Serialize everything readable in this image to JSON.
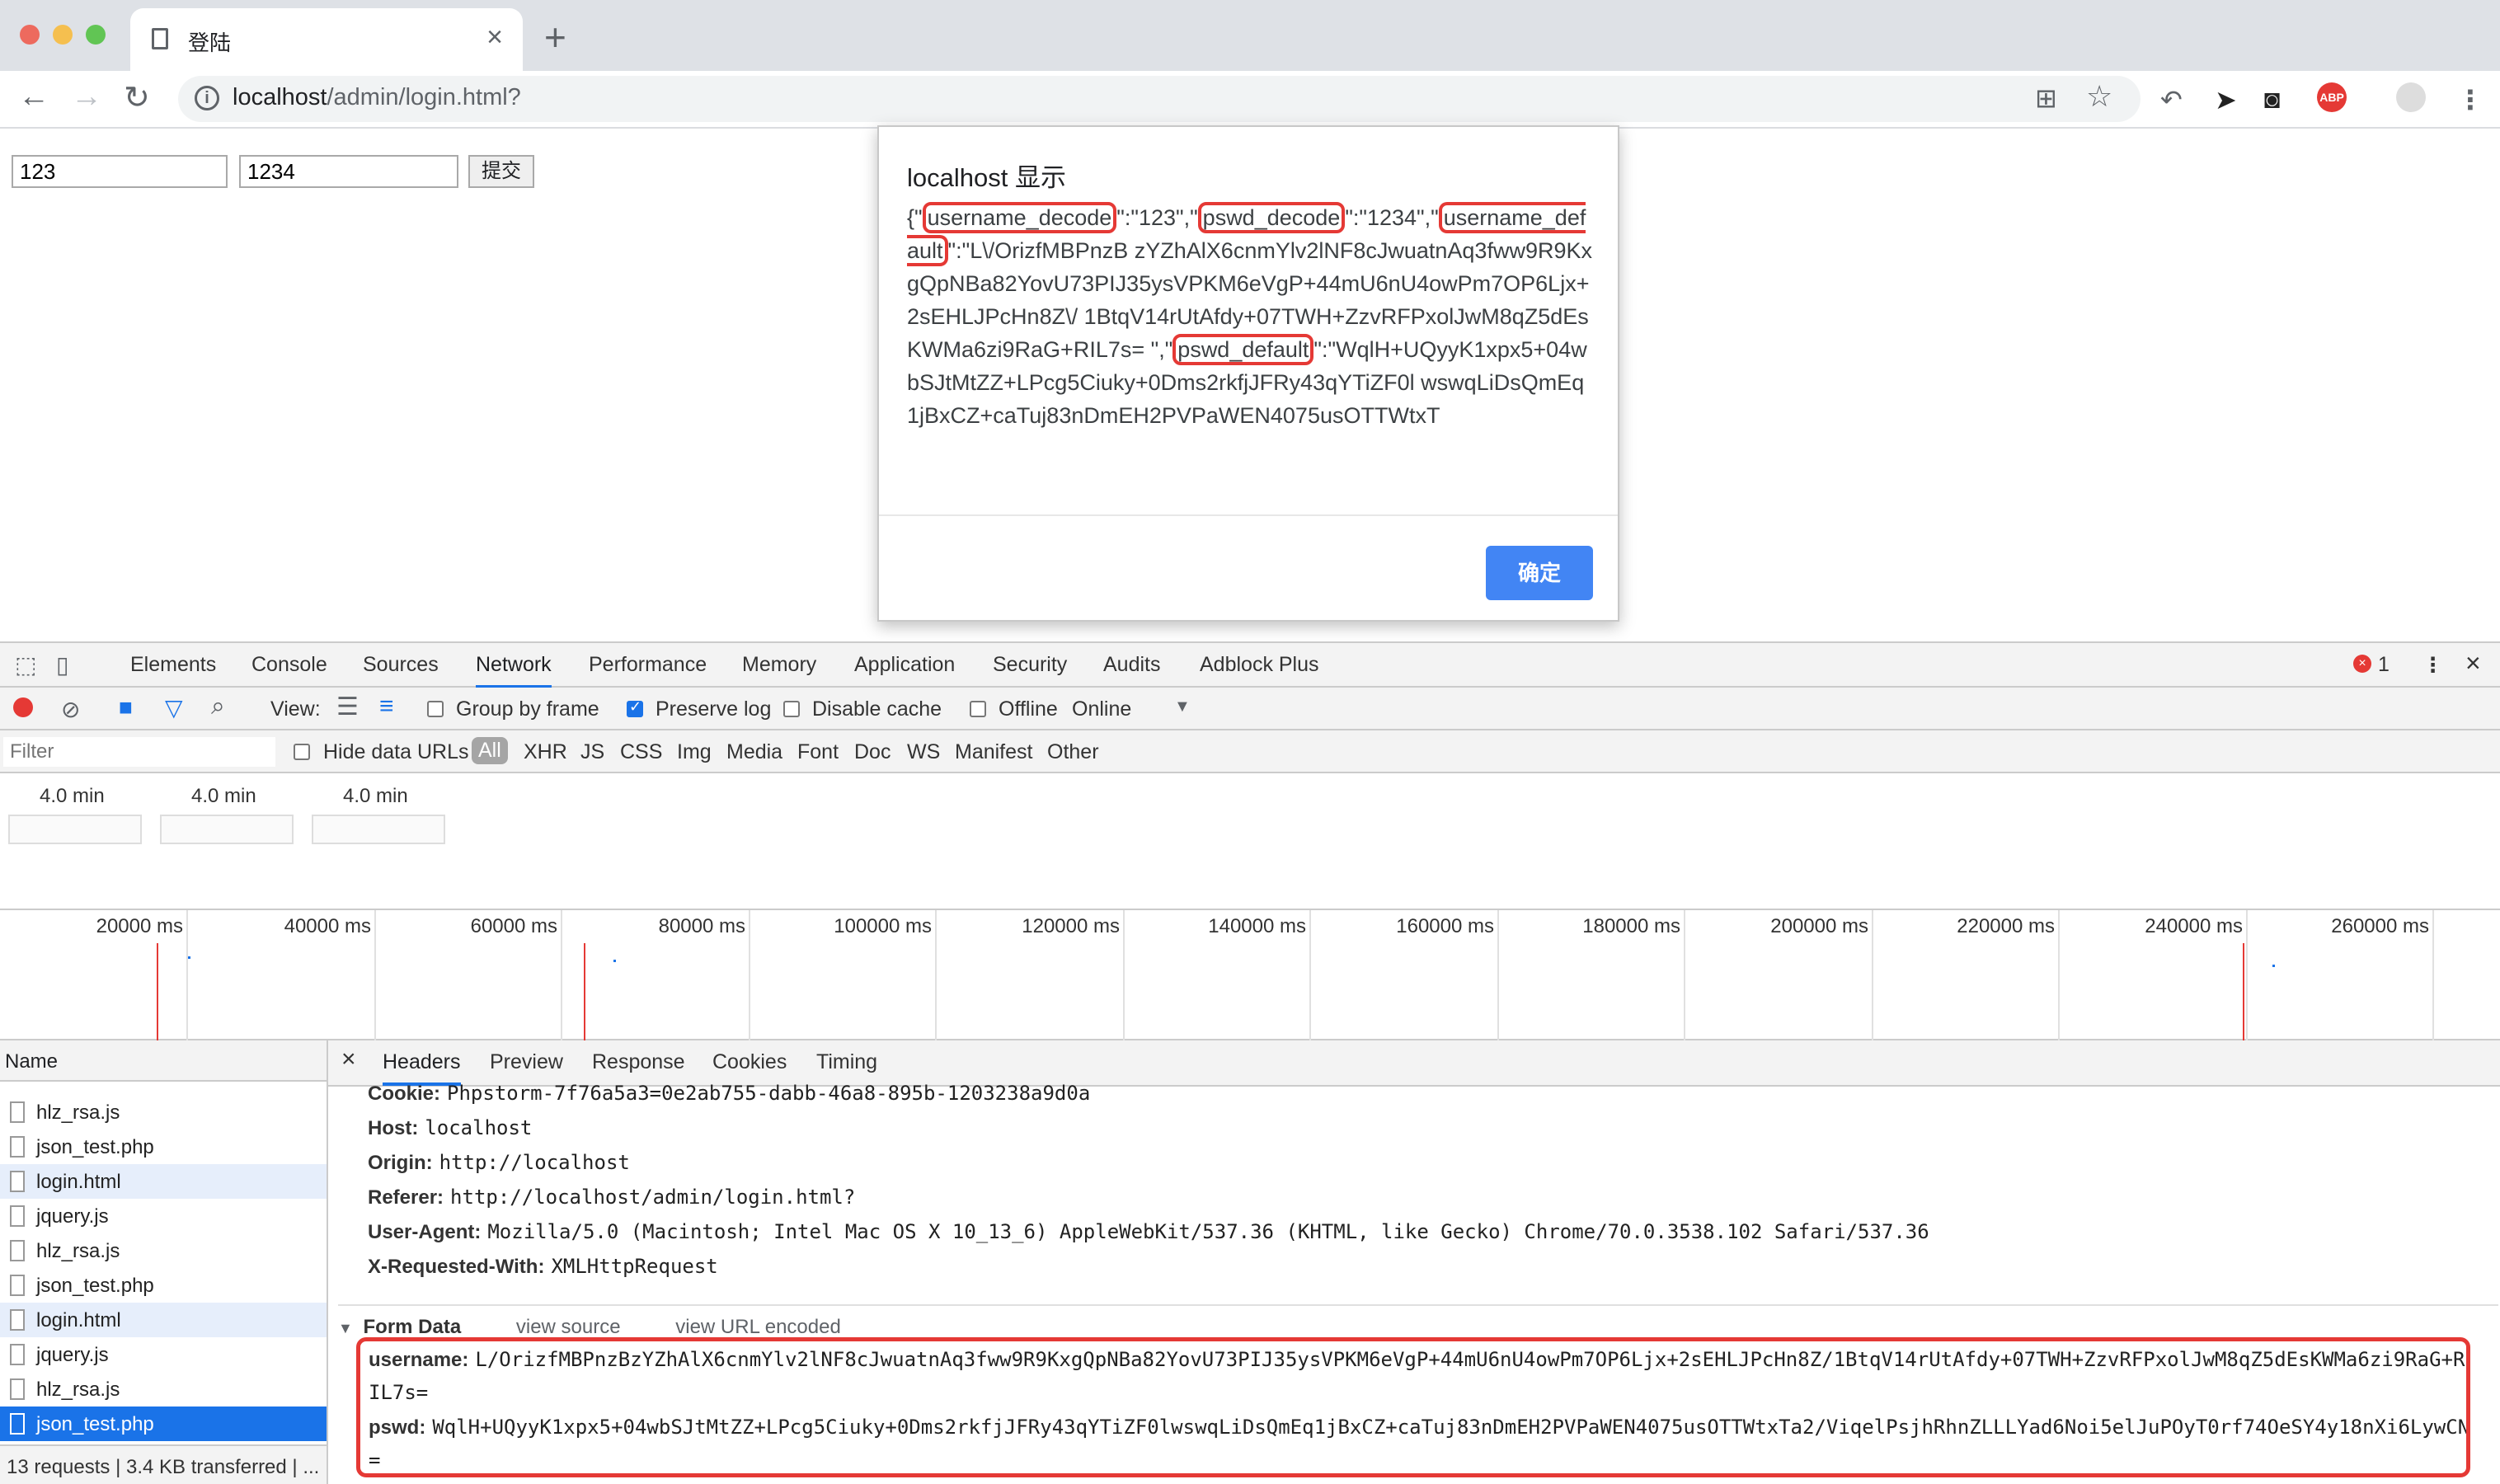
{
  "browser": {
    "tab_title": "登陆",
    "url_host": "localhost",
    "url_path": "/admin/login.html?"
  },
  "page": {
    "username_value": "123",
    "password_value": "1234",
    "submit_label": "提交"
  },
  "alert": {
    "title": "localhost 显示",
    "segments": [
      "{\"",
      "username_decode",
      "\":\"123\",\"",
      "pswd_decode",
      "\":\"1234\",\"",
      "username_default",
      "\":\"L\\/OrizfMBPnzB zYZhAlX6cnmYlv2lNF8cJwuatnAq3fww9R9KxgQpNBa82YovU73PIJ35ysVPKM6eVgP+44mU6nU4owPm7OP6Ljx+2sEHLJPcHn8Z\\/ 1BtqV14rUtAfdy+07TWH+ZzvRFPxolJwM8qZ5dEsKWMa6zi9RaG+RIL7s= \",\"",
      "pswd_default",
      "\":\"WqlH+UQyyK1xpx5+04wbSJtMtZZ+LPcg5Ciuky+0Dms2rkfjJFRy43qYTiZF0l wswqLiDsQmEq1jBxCZ+caTuj83nDmEH2PVPaWEN4075usOTTWtxT"
    ],
    "ok_label": "确定"
  },
  "devtools": {
    "tabs": [
      "Elements",
      "Console",
      "Sources",
      "Network",
      "Performance",
      "Memory",
      "Application",
      "Security",
      "Audits",
      "Adblock Plus"
    ],
    "active_tab": "Network",
    "error_count": "1",
    "toolbar": {
      "view_label": "View:",
      "group_by_frame": "Group by frame",
      "preserve_log": "Preserve log",
      "disable_cache": "Disable cache",
      "offline": "Offline",
      "throttle": "Online"
    },
    "filter": {
      "placeholder": "Filter",
      "hide_data_urls": "Hide data URLs",
      "types": [
        "All",
        "XHR",
        "JS",
        "CSS",
        "Img",
        "Media",
        "Font",
        "Doc",
        "WS",
        "Manifest",
        "Other"
      ]
    },
    "screenshots": [
      "4.0 min",
      "4.0 min",
      "4.0 min"
    ],
    "timeline_ticks": [
      "20000 ms",
      "40000 ms",
      "60000 ms",
      "80000 ms",
      "100000 ms",
      "120000 ms",
      "140000 ms",
      "160000 ms",
      "180000 ms",
      "200000 ms",
      "220000 ms",
      "240000 ms",
      "260000 ms"
    ],
    "list_header": "Name",
    "requests": [
      "hlz_rsa.js",
      "json_test.php",
      "login.html",
      "jquery.js",
      "hlz_rsa.js",
      "json_test.php",
      "login.html",
      "jquery.js",
      "hlz_rsa.js",
      "json_test.php"
    ],
    "status_bar": "13 requests | 3.4 KB transferred | ...",
    "detail_tabs": [
      "Headers",
      "Preview",
      "Response",
      "Cookies",
      "Timing"
    ],
    "headers": [
      {
        "k": "Cookie:",
        "v": "Phpstorm-7f76a5a3=0e2ab755-dabb-46a8-895b-1203238a9d0a"
      },
      {
        "k": "Host:",
        "v": "localhost"
      },
      {
        "k": "Origin:",
        "v": "http://localhost"
      },
      {
        "k": "Referer:",
        "v": "http://localhost/admin/login.html?"
      },
      {
        "k": "User-Agent:",
        "v": "Mozilla/5.0 (Macintosh; Intel Mac OS X 10_13_6) AppleWebKit/537.36 (KHTML, like Gecko) Chrome/70.0.3538.102 Safari/537.36"
      },
      {
        "k": "X-Requested-With:",
        "v": "XMLHttpRequest"
      }
    ],
    "form_data": {
      "title": "Form Data",
      "view_source": "view source",
      "view_url_encoded": "view URL encoded",
      "username_key": "username:",
      "username_value": "L/OrizfMBPnzBzYZhAlX6cnmYlv2lNF8cJwuatnAq3fww9R9KxgQpNBa82YovU73PIJ35ysVPKM6eVgP+44mU6nU4owPm7OP6Ljx+2sEHLJPcHn8Z/1BtqV14rUtAfdy+07TWH+ZzvRFPxolJwM8qZ5dEsKWMa6zi9RaG+R",
      "username_value_cont": "IL7s=",
      "pswd_key": "pswd:",
      "pswd_value": "WqlH+UQyyK1xpx5+04wbSJtMtZZ+LPcg5Ciuky+0Dms2rkfjJFRy43qYTiZF0lwswqLiDsQmEq1jBxCZ+caTuj83nDmEH2PVPaWEN4075usOTTWtxTa2/ViqelPsjhRhnZLLLYad6Noi5elJuPOyT0rf74OeSY4y18nXi6LywCN",
      "pswd_value_cont": "="
    }
  }
}
